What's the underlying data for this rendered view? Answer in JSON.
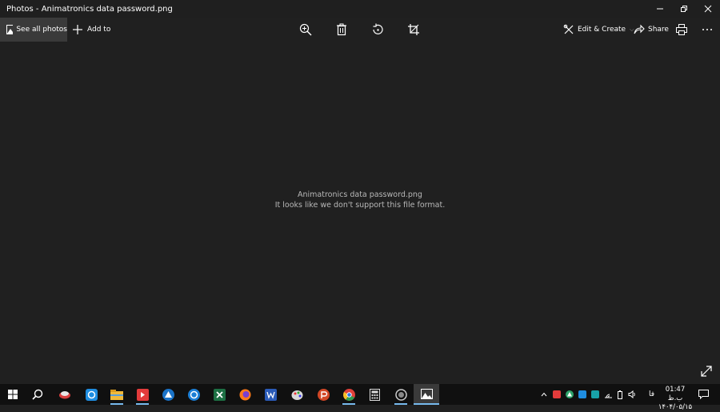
{
  "window": {
    "title": "Photos - Animatronics data password.png"
  },
  "toolbar": {
    "see_all_label": "See all photos",
    "add_to_label": "Add to",
    "edit_create_label": "Edit & Create",
    "share_label": "Share"
  },
  "main": {
    "file_name": "Animatronics data password.png",
    "error_message": "It looks like we don't support this file format."
  },
  "taskbar": {
    "language": "فا",
    "time": "01:47 ب.ظ",
    "date": "۱۴۰۴/۰۵/۱۵"
  },
  "colors": {
    "app_background": "#202020",
    "taskbar_background": "#101010",
    "accent": "#76b9ed"
  }
}
